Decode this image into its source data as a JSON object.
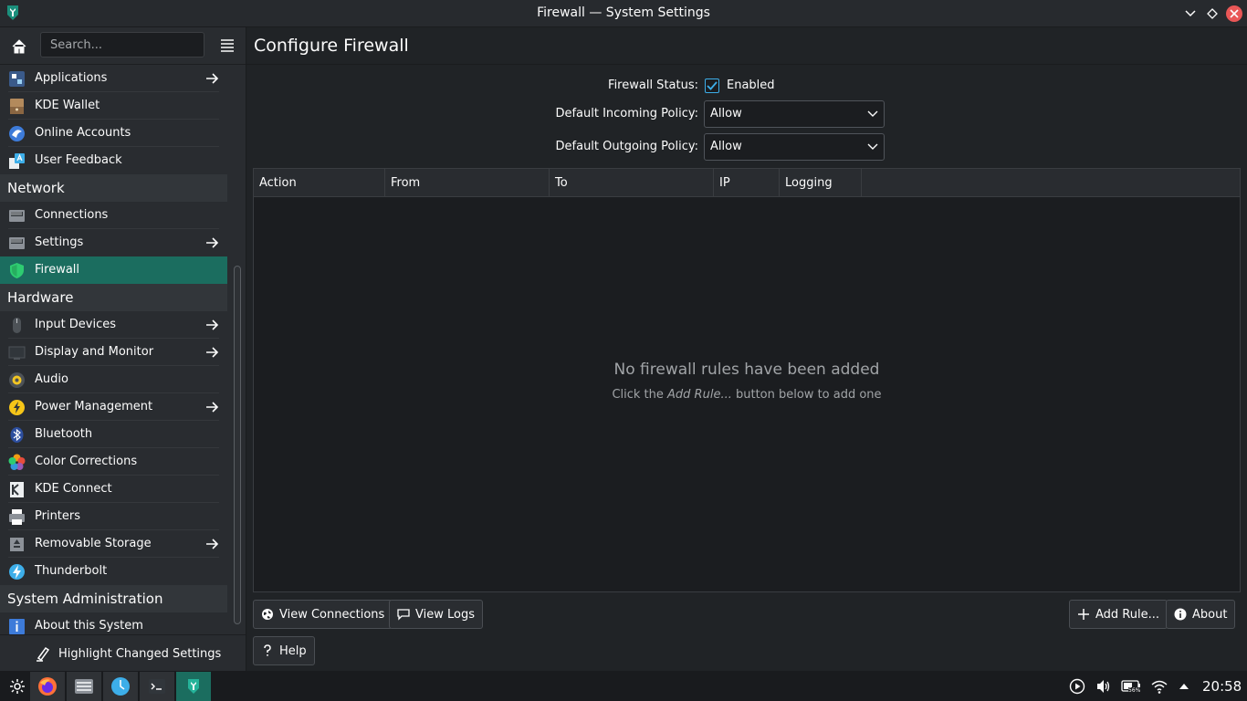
{
  "window": {
    "title": "Firewall — System Settings"
  },
  "sidebar": {
    "search_placeholder": "Search...",
    "items": [
      {
        "label": "Applications",
        "kind": "item",
        "arrow": true
      },
      {
        "label": "KDE Wallet",
        "kind": "item"
      },
      {
        "label": "Online Accounts",
        "kind": "item"
      },
      {
        "label": "User Feedback",
        "kind": "item"
      },
      {
        "label": "Network",
        "kind": "category"
      },
      {
        "label": "Connections",
        "kind": "item"
      },
      {
        "label": "Settings",
        "kind": "item",
        "arrow": true
      },
      {
        "label": "Firewall",
        "kind": "item",
        "selected": true
      },
      {
        "label": "Hardware",
        "kind": "category"
      },
      {
        "label": "Input Devices",
        "kind": "item",
        "arrow": true
      },
      {
        "label": "Display and Monitor",
        "kind": "item",
        "arrow": true
      },
      {
        "label": "Audio",
        "kind": "item"
      },
      {
        "label": "Power Management",
        "kind": "item",
        "arrow": true
      },
      {
        "label": "Bluetooth",
        "kind": "item"
      },
      {
        "label": "Color Corrections",
        "kind": "item"
      },
      {
        "label": "KDE Connect",
        "kind": "item"
      },
      {
        "label": "Printers",
        "kind": "item"
      },
      {
        "label": "Removable Storage",
        "kind": "item",
        "arrow": true
      },
      {
        "label": "Thunderbolt",
        "kind": "item"
      },
      {
        "label": "System Administration",
        "kind": "category"
      },
      {
        "label": "About this System",
        "kind": "item"
      }
    ],
    "footer_label": "Highlight Changed Settings"
  },
  "main": {
    "title": "Configure Firewall",
    "status_label": "Firewall Status:",
    "status_value": "Enabled",
    "status_checked": true,
    "incoming_label": "Default Incoming Policy:",
    "incoming_value": "Allow",
    "outgoing_label": "Default Outgoing Policy:",
    "outgoing_value": "Allow",
    "columns": [
      "Action",
      "From",
      "To",
      "IP",
      "Logging"
    ],
    "empty_title": "No firewall rules have been added",
    "empty_sub_prefix": "Click the ",
    "empty_sub_em": "Add Rule...",
    "empty_sub_suffix": " button below to add one",
    "buttons": {
      "view_connections": "View Connections",
      "view_logs": "View Logs",
      "add_rule": "Add Rule...",
      "about": "About",
      "help": "Help"
    }
  },
  "taskbar": {
    "clock": "20:58",
    "battery": "56%"
  },
  "colors": {
    "accent": "#1b6d5f",
    "background": "#202326",
    "sidebar": "#292c30",
    "close": "#e95757"
  }
}
